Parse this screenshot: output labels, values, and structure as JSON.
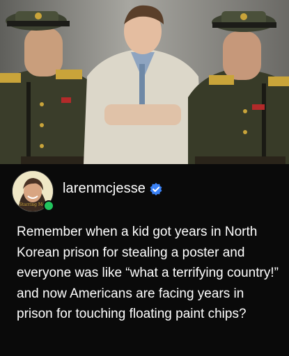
{
  "post": {
    "username": "larenmcjesse",
    "verified": true,
    "avatar_caption": "Starring Me",
    "text": "Remember when a kid got years in North Korean prison for stealing a poster and everyone was like “what a terrifying country!” and now Americans are facing years in prison for touching floating paint chips?"
  },
  "colors": {
    "background": "#0a0a0a",
    "text": "#ffffff",
    "verified_badge": "#3b82f6",
    "online_indicator": "#22c55e"
  },
  "icons": [
    "verified-badge-icon",
    "online-status-icon"
  ]
}
